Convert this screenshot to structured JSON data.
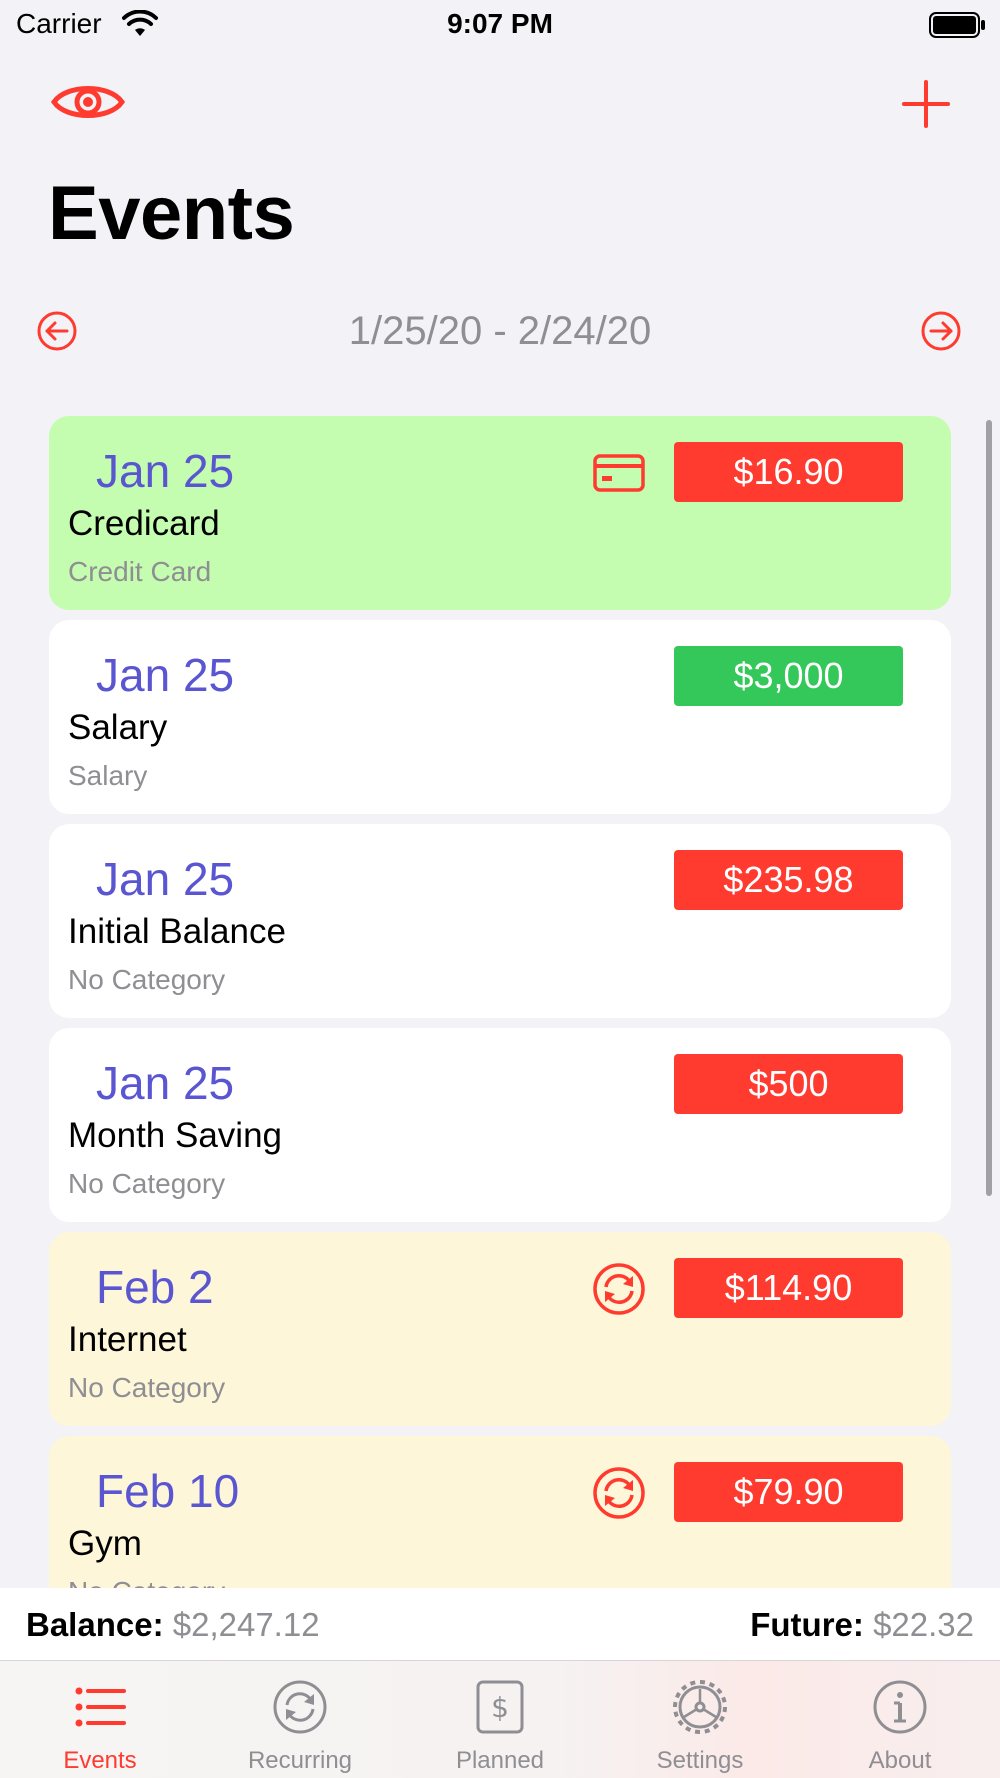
{
  "status_bar": {
    "carrier": "Carrier",
    "time": "9:07 PM"
  },
  "header": {
    "title": "Events"
  },
  "date_range": {
    "label": "1/25/20 - 2/24/20"
  },
  "events": [
    {
      "date": "Jan 25",
      "name": "Credicard",
      "category": "Credit Card",
      "amount": "$16.90",
      "kind": "expense",
      "icon": "credit-card-icon",
      "style": "credit-card"
    },
    {
      "date": "Jan 25",
      "name": "Salary",
      "category": "Salary",
      "amount": "$3,000",
      "kind": "income",
      "icon": "",
      "style": "normal"
    },
    {
      "date": "Jan 25",
      "name": "Initial Balance",
      "category": "No Category",
      "amount": "$235.98",
      "kind": "expense",
      "icon": "",
      "style": "normal"
    },
    {
      "date": "Jan 25",
      "name": "Month Saving",
      "category": "No Category",
      "amount": "$500",
      "kind": "expense",
      "icon": "",
      "style": "normal"
    },
    {
      "date": "Feb 2",
      "name": "Internet",
      "category": "No Category",
      "amount": "$114.90",
      "kind": "expense",
      "icon": "recurring-icon",
      "style": "recurring"
    },
    {
      "date": "Feb 10",
      "name": "Gym",
      "category": "No Category",
      "amount": "$79.90",
      "kind": "expense",
      "icon": "recurring-icon",
      "style": "recurring"
    }
  ],
  "footer": {
    "balance_label": "Balance:",
    "balance_value": "$2,247.12",
    "future_label": "Future:",
    "future_value": "$22.32"
  },
  "tabs": [
    {
      "label": "Events",
      "icon": "list-icon",
      "active": true
    },
    {
      "label": "Recurring",
      "icon": "recurring-tab-icon",
      "active": false
    },
    {
      "label": "Planned",
      "icon": "dollar-doc-icon",
      "active": false
    },
    {
      "label": "Settings",
      "icon": "gear-icon",
      "active": false
    },
    {
      "label": "About",
      "icon": "info-icon",
      "active": false
    }
  ],
  "colors": {
    "accent": "#ff3b30",
    "income": "#34c759",
    "date_text": "#5a56d1",
    "credit_card_row": "#c4fcb0",
    "recurring_row": "#fdf6d8"
  }
}
